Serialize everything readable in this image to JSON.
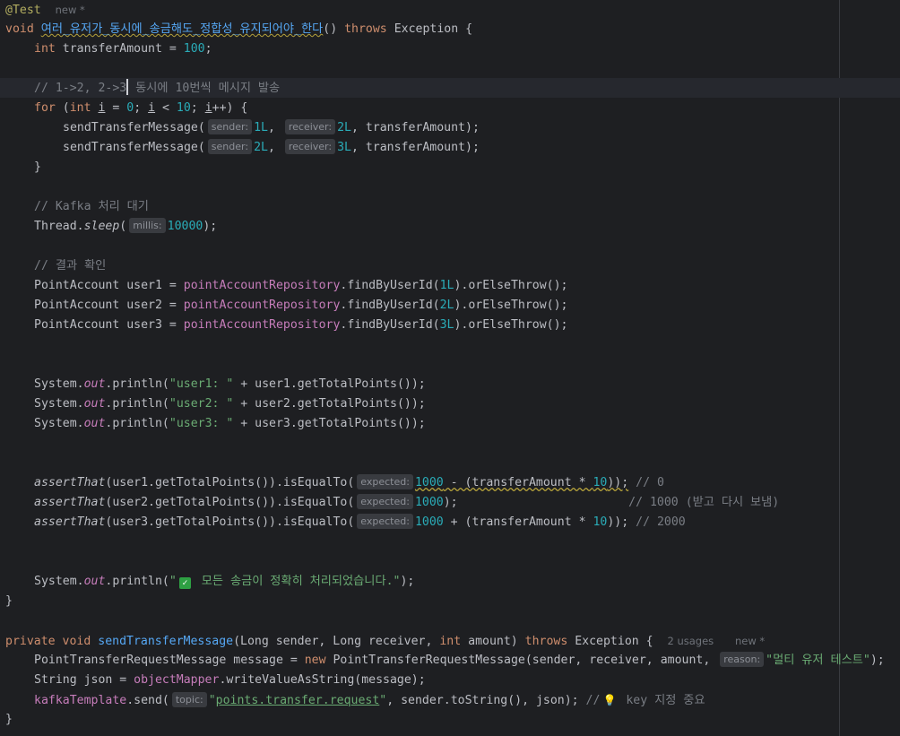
{
  "test_method": {
    "annotation": "@Test",
    "annotation_badge": "new *",
    "kw_void": "void",
    "name": "여러_유저가_동시에_송금해도_정합성_유지되어야_한다",
    "parens": "() ",
    "kw_throws": "throws",
    "exception": " Exception {",
    "amount_type": "int",
    "amount_decl": " transferAmount = ",
    "amount_value": "100",
    "semi": ";",
    "loop_comment_a": "// 1->2, 2->3",
    "loop_comment_b": " 동시에 10번씩 메시지 발송",
    "kw_for": "for",
    "for_open": " (",
    "kw_int": "int",
    "var_i": "i",
    "eq": " = ",
    "zero": "0",
    "semi_space": "; ",
    "lt": " < ",
    "ten": "10",
    "inc": "++) {",
    "send_call": "sendTransferMessage(",
    "hint_sender": "sender:",
    "hint_receiver": "receiver:",
    "arg_1L": "1L",
    "arg_2L": "2L",
    "arg_3L": "3L",
    "comma": ", ",
    "args_tail": ", transferAmount);",
    "close_brace": "}",
    "kafka_comment": "// Kafka 처리 대기",
    "thread": "Thread.",
    "sleep": "sleep",
    "open_paren": "(",
    "hint_millis": "millis:",
    "sleep_ms": "10000",
    "close_semi": ");",
    "verify_comment": "// 결과 확인",
    "point_account": "PointAccount ",
    "user1_var": "user1",
    "user2_var": "user2",
    "user3_var": "user3",
    "repo": "pointAccountRepository",
    "find_call": ".findByUserId(",
    "find_tail": ").orElseThrow();",
    "system": "System.",
    "out": "out",
    "println": ".println(",
    "str_user1": "\"user1: \"",
    "str_user2": "\"user2: \"",
    "str_user3": "\"user3: \"",
    "plus": " + ",
    "user1_total": "user1.getTotalPoints());",
    "user2_total": "user2.getTotalPoints());",
    "user3_total": "user3.getTotalPoints());",
    "assert_that": "assertThat",
    "assert_user1": "(user1.getTotalPoints()).isEqualTo(",
    "assert_user2": "(user2.getTotalPoints()).isEqualTo(",
    "assert_user3": "(user3.getTotalPoints()).isEqualTo(",
    "hint_expected": "expected:",
    "expected_base": "1000",
    "minus_open": " - (transferAmount * ",
    "plus_open": " + (transferAmount * ",
    "close_calc": "));",
    "comment_0": "// 0",
    "comment_1000": "// 1000 (받고 다시 보냄)",
    "comment_2000": "// 2000",
    "done_str_open": "\"",
    "done_icon": "check-mark",
    "done_str_text": " 모든 송금이 정확히 처리되었습니다.\"",
    "end_brace": "}"
  },
  "helper_method": {
    "kw_private": "private",
    "kw_void": "void",
    "name": "sendTransferMessage",
    "params_a": "(Long sender, Long receiver, ",
    "kw_int": "int",
    "params_b": " amount) ",
    "kw_throws": "throws",
    "exception": " Exception {",
    "usages": "2 usages",
    "badge": "new *",
    "msg_decl": "PointTransferRequestMessage message = ",
    "kw_new": "new",
    "msg_ctor": " PointTransferRequestMessage(sender, receiver, amount, ",
    "hint_reason": "reason:",
    "reason_str": "\"멀티 유저 테스트\"",
    "msg_end": ");",
    "json_decl": "String json = ",
    "mapper": "objectMapper",
    "json_call": ".writeValueAsString(message);",
    "kafka": "kafkaTemplate",
    "send_open": ".send(",
    "hint_topic": "topic:",
    "topic_q1": "\"",
    "topic": "points.transfer.request",
    "topic_q2": "\"",
    "send_tail": ", sender.toString(), json); ",
    "comment_slash": "//",
    "tip_icon": "lightbulb",
    "comment_key": " key 지정 중요",
    "end_brace": "}"
  },
  "colors": {
    "background": "#1e1f22",
    "keyword": "#cf8e6d",
    "number": "#2aacb8",
    "string": "#6aab73",
    "comment": "#7a7e85",
    "method": "#56a8f5",
    "field": "#c77dbb",
    "annotation": "#b3ae60"
  }
}
